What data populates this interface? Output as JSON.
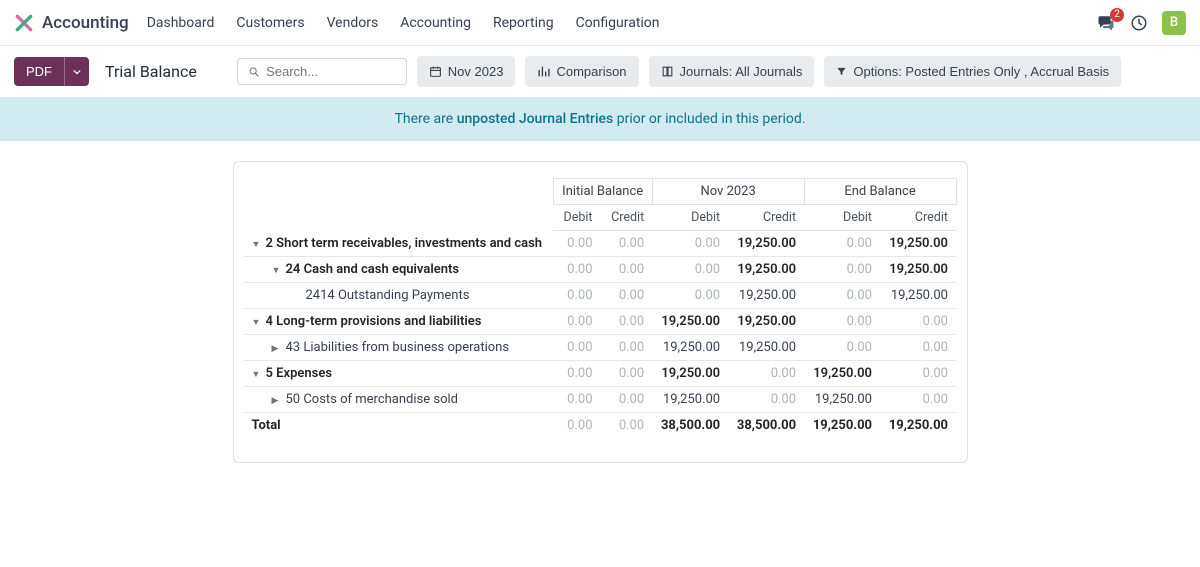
{
  "app": {
    "title": "Accounting"
  },
  "nav": {
    "items": [
      "Dashboard",
      "Customers",
      "Vendors",
      "Accounting",
      "Reporting",
      "Configuration"
    ]
  },
  "header": {
    "pdf_label": "PDF",
    "breadcrumb": "Trial Balance",
    "search_placeholder": "Search...",
    "period_label": "Nov 2023",
    "comparison_label": "Comparison",
    "journals_label": "Journals: All Journals",
    "options_label": "Options: Posted Entries Only , Accrual Basis"
  },
  "notifications": {
    "badge": "2",
    "avatar_letter": "B"
  },
  "alert": {
    "prefix": "There are ",
    "link": "unposted Journal Entries",
    "suffix": " prior or included in this period."
  },
  "report": {
    "groups": [
      "Initial Balance",
      "Nov 2023",
      "End Balance"
    ],
    "sub": [
      "Debit",
      "Credit",
      "Debit",
      "Credit",
      "Debit",
      "Credit"
    ],
    "rows": [
      {
        "label": "2 Short term receivables, investments and cash",
        "bold": true,
        "caret": "down",
        "indent": 0,
        "vals": [
          "0.00",
          "0.00",
          "0.00",
          "19,250.00",
          "0.00",
          "19,250.00"
        ],
        "nz": [
          0,
          0,
          0,
          1,
          0,
          1
        ]
      },
      {
        "label": "24 Cash and cash equivalents",
        "bold": true,
        "caret": "down",
        "indent": 1,
        "vals": [
          "0.00",
          "0.00",
          "0.00",
          "19,250.00",
          "0.00",
          "19,250.00"
        ],
        "nz": [
          0,
          0,
          0,
          1,
          0,
          1
        ]
      },
      {
        "label": "2414 Outstanding Payments",
        "bold": false,
        "caret": "",
        "indent": 2,
        "vals": [
          "0.00",
          "0.00",
          "0.00",
          "19,250.00",
          "0.00",
          "19,250.00"
        ],
        "nz": [
          0,
          0,
          0,
          1,
          0,
          1
        ]
      },
      {
        "label": "4 Long-term provisions and liabilities",
        "bold": true,
        "caret": "down",
        "indent": 0,
        "vals": [
          "0.00",
          "0.00",
          "19,250.00",
          "19,250.00",
          "0.00",
          "0.00"
        ],
        "nz": [
          0,
          0,
          1,
          1,
          0,
          0
        ]
      },
      {
        "label": "43 Liabilities from business operations",
        "bold": false,
        "caret": "right",
        "indent": 1,
        "vals": [
          "0.00",
          "0.00",
          "19,250.00",
          "19,250.00",
          "0.00",
          "0.00"
        ],
        "nz": [
          0,
          0,
          1,
          1,
          0,
          0
        ]
      },
      {
        "label": "5 Expenses",
        "bold": true,
        "caret": "down",
        "indent": 0,
        "vals": [
          "0.00",
          "0.00",
          "19,250.00",
          "0.00",
          "19,250.00",
          "0.00"
        ],
        "nz": [
          0,
          0,
          1,
          0,
          1,
          0
        ]
      },
      {
        "label": "50 Costs of merchandise sold",
        "bold": false,
        "caret": "right",
        "indent": 1,
        "vals": [
          "0.00",
          "0.00",
          "19,250.00",
          "0.00",
          "19,250.00",
          "0.00"
        ],
        "nz": [
          0,
          0,
          1,
          0,
          1,
          0
        ]
      }
    ],
    "total": {
      "label": "Total",
      "vals": [
        "0.00",
        "0.00",
        "38,500.00",
        "38,500.00",
        "19,250.00",
        "19,250.00"
      ],
      "nz": [
        0,
        0,
        1,
        1,
        1,
        1
      ]
    }
  }
}
